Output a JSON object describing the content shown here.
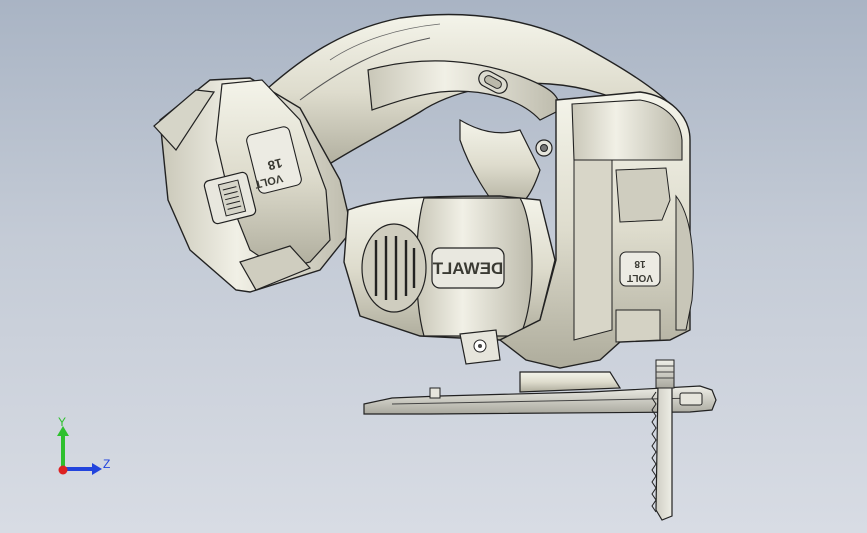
{
  "model": {
    "brand_label": "DEWALT",
    "battery_label_number": "18",
    "battery_label_unit": "VOLT",
    "motor_label_number": "18",
    "motor_label_unit": "VOLT"
  },
  "triad": {
    "y_label": "Y",
    "z_label": "Z",
    "colors": {
      "y": "#2ec02e",
      "z": "#2244dd",
      "x": "#dd2222"
    }
  }
}
